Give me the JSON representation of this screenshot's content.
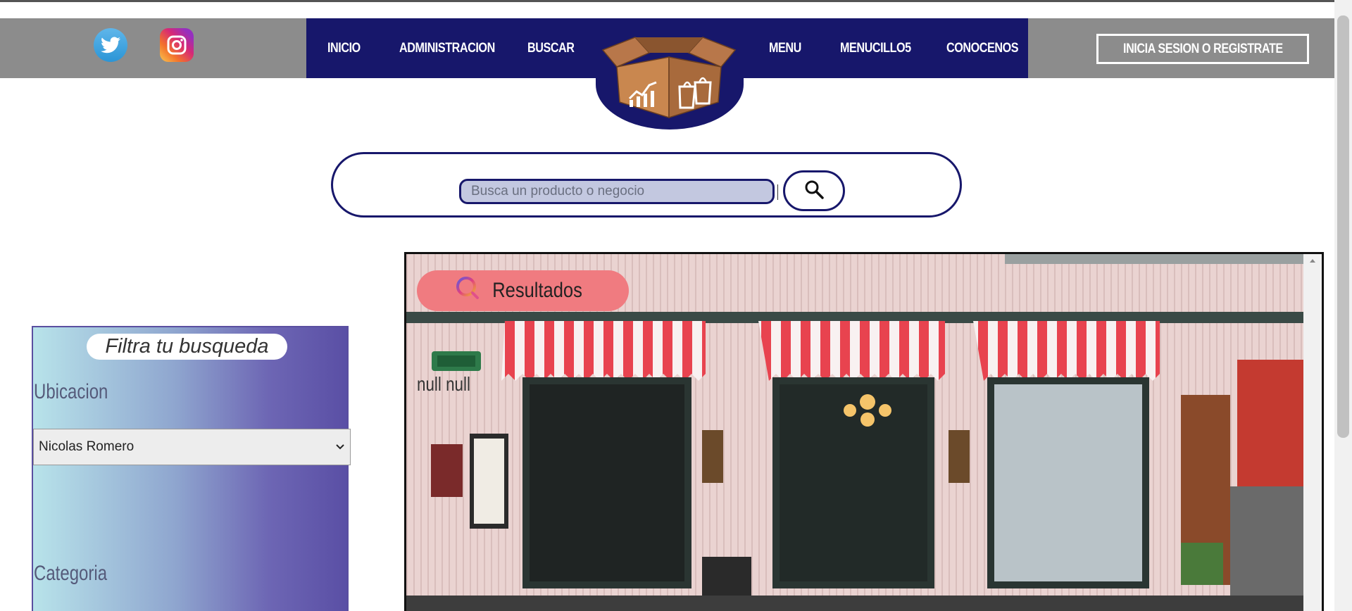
{
  "header": {
    "social": [
      {
        "name": "twitter-icon"
      },
      {
        "name": "instagram-icon"
      }
    ],
    "nav_items": [
      "INICIO",
      "ADMINISTRACION",
      "BUSCAR",
      "MENU",
      "MENUCILLO5",
      "CONOCENOS"
    ],
    "login_label": "INICIA SESION O REGISTRATE",
    "colors": {
      "nav_bg": "#17176b",
      "header_bg": "#8c8c8c",
      "box": "#b8774a"
    }
  },
  "search": {
    "placeholder": "Busca un producto o negocio",
    "icon": "search-icon"
  },
  "filters": {
    "title": "Filtra tu busqueda",
    "location_label": "Ubicacion",
    "location_value": "Nicolas Romero",
    "category_label": "Categoria"
  },
  "results": {
    "pill_label": "Resultados",
    "null_text": "null null",
    "pill_color": "#f07b80"
  }
}
